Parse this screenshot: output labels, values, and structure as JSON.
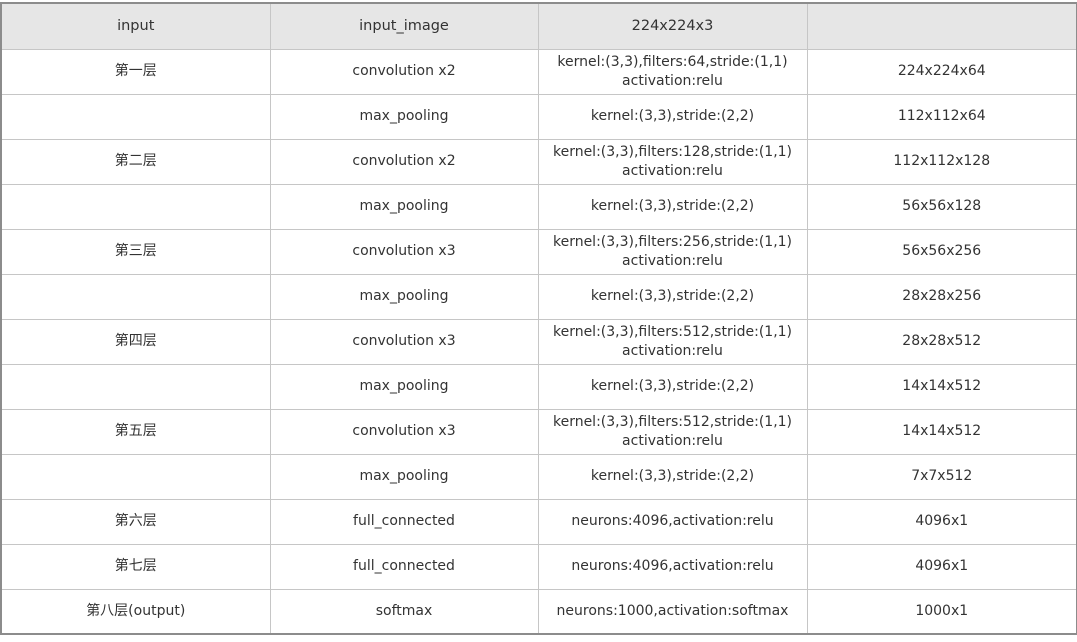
{
  "header": [
    "input",
    "input_image",
    "224x224x3",
    ""
  ],
  "rows": [
    {
      "layer": "第一层",
      "op": "convolution x2",
      "params": [
        "kernel:(3,3),filters:64,stride:(1,1)",
        "activation:relu"
      ],
      "output": "224x224x64"
    },
    {
      "layer": "",
      "op": "max_pooling",
      "params": [
        "kernel:(3,3),stride:(2,2)"
      ],
      "output": "112x112x64"
    },
    {
      "layer": "第二层",
      "op": "convolution x2",
      "params": [
        "kernel:(3,3),filters:128,stride:(1,1)",
        "activation:relu"
      ],
      "output": "112x112x128"
    },
    {
      "layer": "",
      "op": "max_pooling",
      "params": [
        "kernel:(3,3),stride:(2,2)"
      ],
      "output": "56x56x128"
    },
    {
      "layer": "第三层",
      "op": "convolution x3",
      "params": [
        "kernel:(3,3),filters:256,stride:(1,1)",
        "activation:relu"
      ],
      "output": "56x56x256"
    },
    {
      "layer": "",
      "op": "max_pooling",
      "params": [
        "kernel:(3,3),stride:(2,2)"
      ],
      "output": "28x28x256"
    },
    {
      "layer": "第四层",
      "op": "convolution x3",
      "params": [
        "kernel:(3,3),filters:512,stride:(1,1)",
        "activation:relu"
      ],
      "output": "28x28x512"
    },
    {
      "layer": "",
      "op": "max_pooling",
      "params": [
        "kernel:(3,3),stride:(2,2)"
      ],
      "output": "14x14x512"
    },
    {
      "layer": "第五层",
      "op": "convolution x3",
      "params": [
        "kernel:(3,3),filters:512,stride:(1,1)",
        "activation:relu"
      ],
      "output": "14x14x512"
    },
    {
      "layer": "",
      "op": "max_pooling",
      "params": [
        "kernel:(3,3),stride:(2,2)"
      ],
      "output": "7x7x512"
    },
    {
      "layer": "第六层",
      "op": "full_connected",
      "params": [
        "neurons:4096,activation:relu"
      ],
      "output": "4096x1"
    },
    {
      "layer": "第七层",
      "op": "full_connected",
      "params": [
        "neurons:4096,activation:relu"
      ],
      "output": "4096x1"
    },
    {
      "layer": "第八层(output)",
      "op": "softmax",
      "params": [
        "neurons:1000,activation:softmax"
      ],
      "output": "1000x1"
    }
  ]
}
